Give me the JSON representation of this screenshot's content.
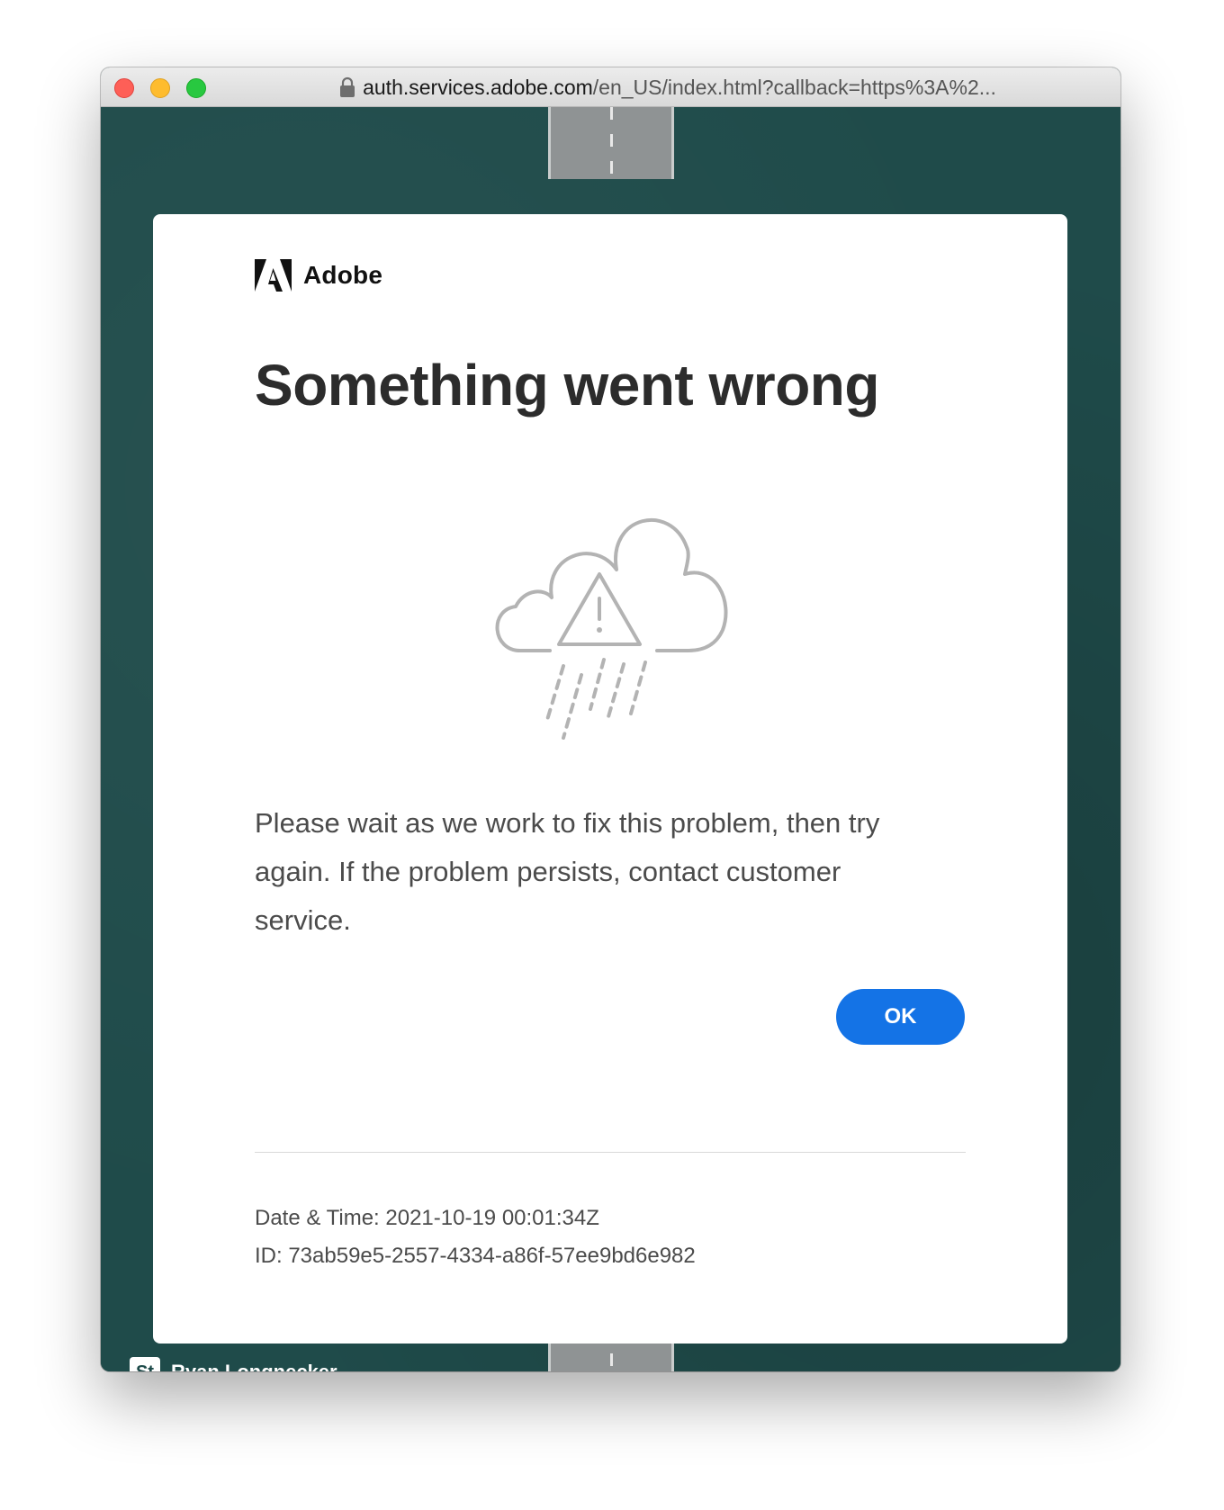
{
  "browser": {
    "url_host": "auth.services.adobe.com",
    "url_path": "/en_US/index.html?callback=https%3A%2..."
  },
  "brand": {
    "name": "Adobe"
  },
  "error": {
    "title": "Something went wrong",
    "message": "Please wait as we work to fix this problem, then try again. If the problem persists, contact customer service.",
    "ok_label": "OK",
    "date_time": "Date & Time: 2021-10-19 00:01:34Z",
    "id": "ID: 73ab59e5-2557-4334-a86f-57ee9bd6e982"
  },
  "credit": {
    "badge": "St",
    "name": "Ryan Longnecker"
  },
  "colors": {
    "accent": "#1473e6",
    "background": "#1d4a49",
    "card": "#ffffff",
    "illustration": "#b3b3b3"
  },
  "icons": [
    "lock-icon",
    "adobe-logo-icon",
    "cloud-error-icon",
    "adobe-stock-icon"
  ]
}
